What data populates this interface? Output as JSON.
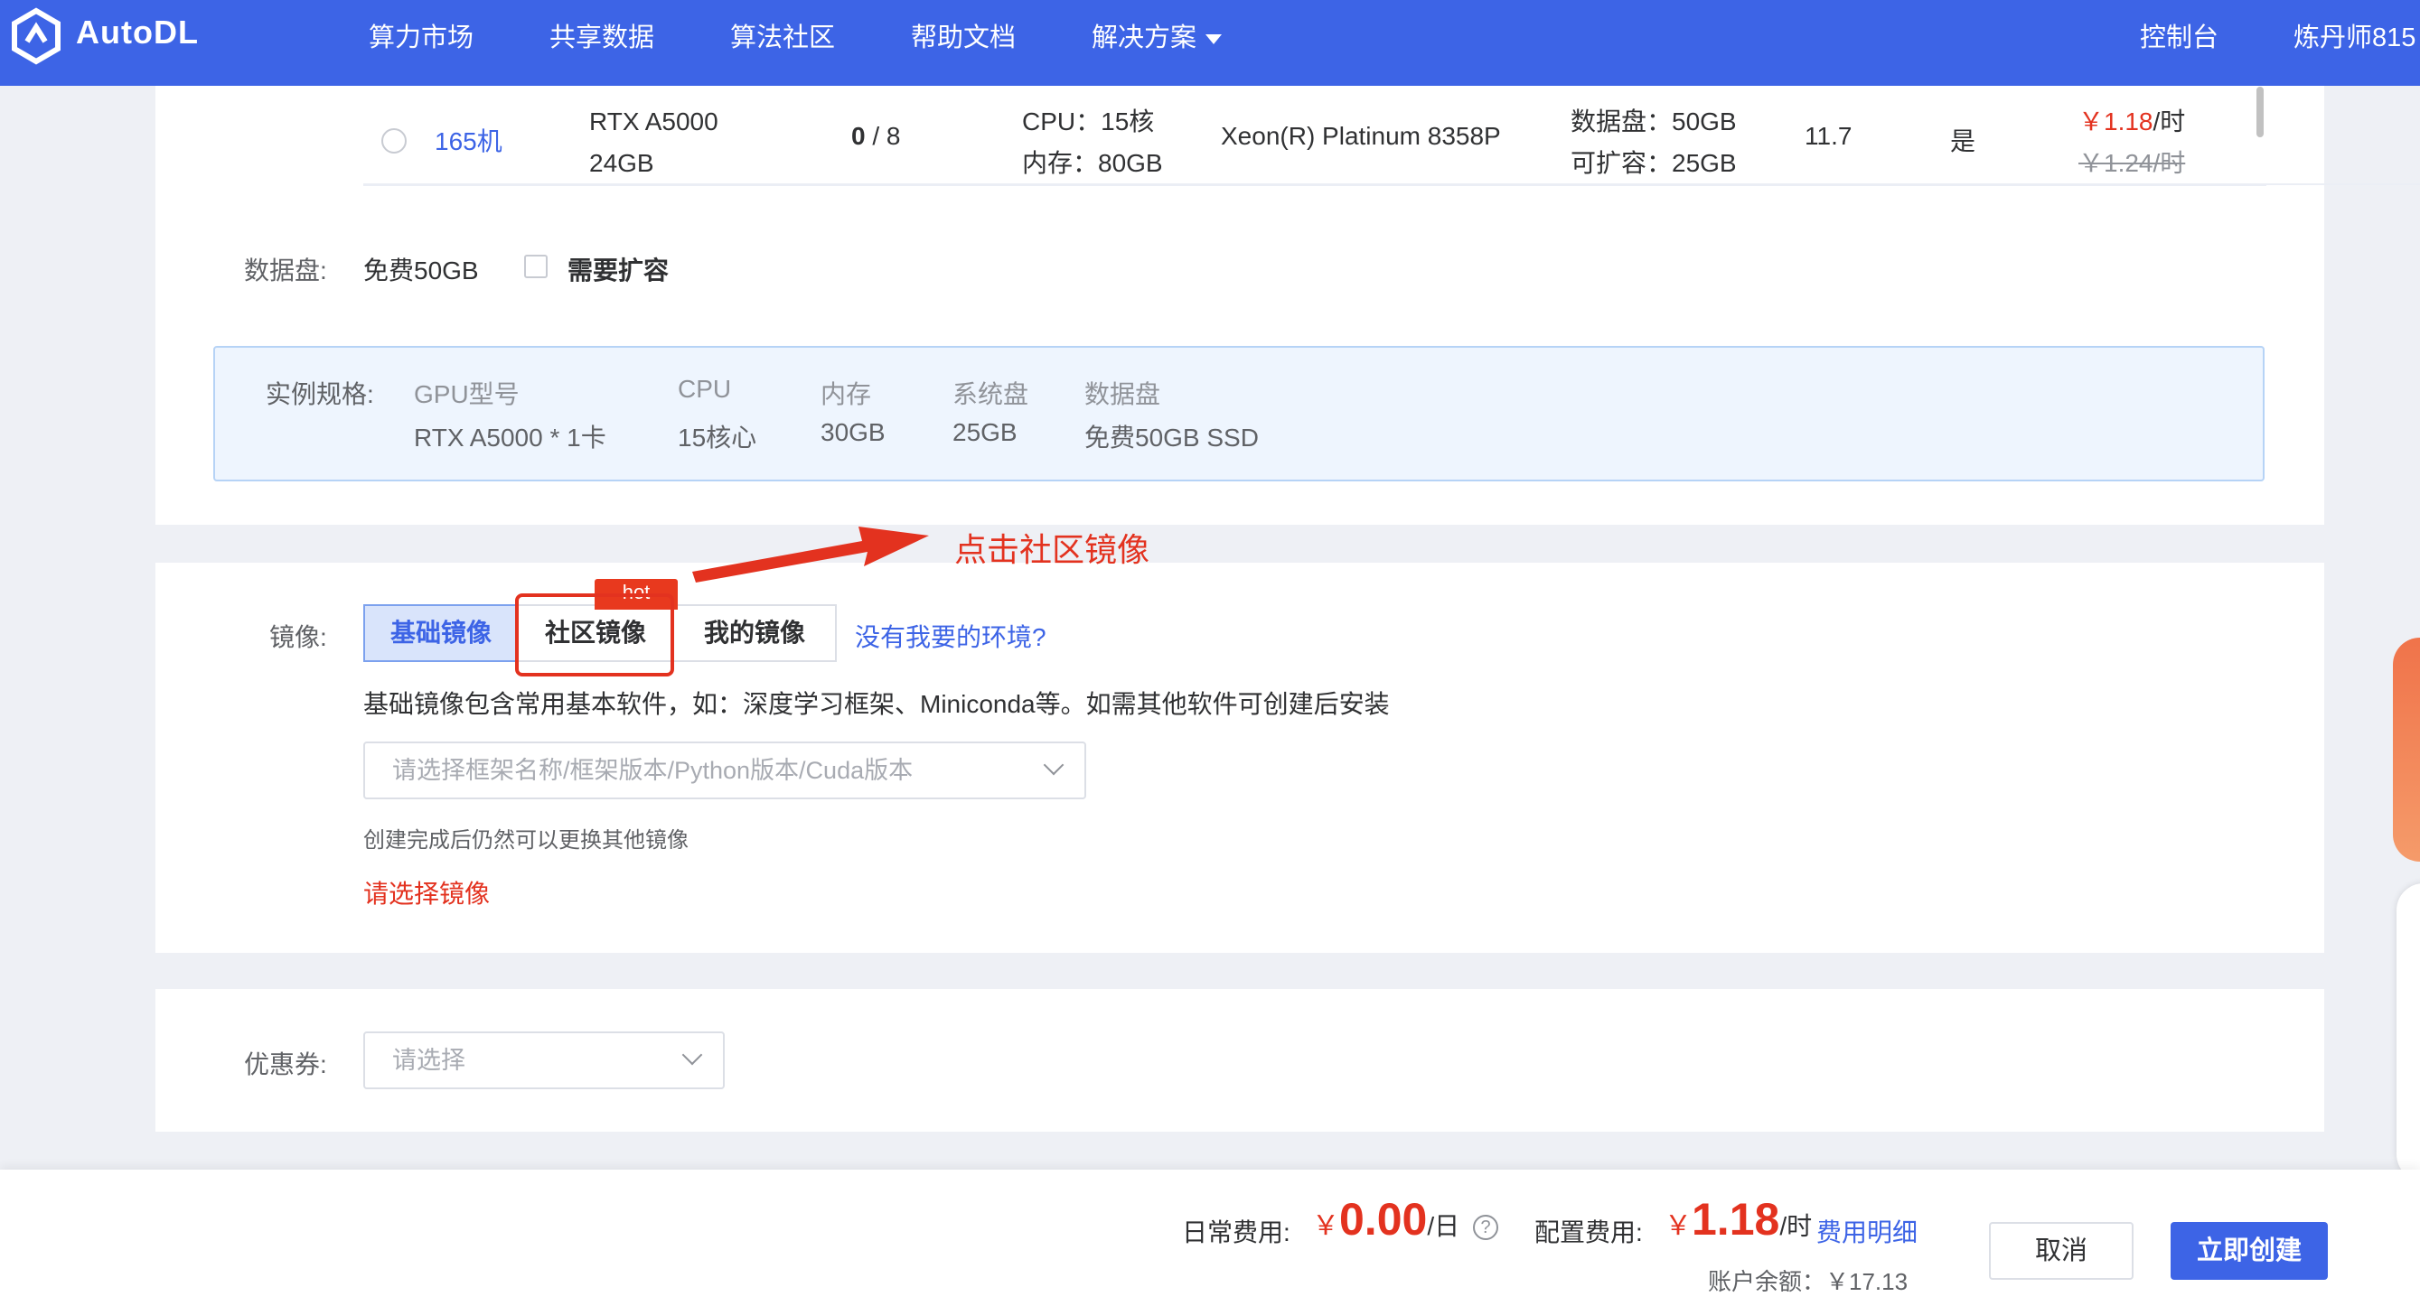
{
  "nav": {
    "brand": "AutoDL",
    "items": [
      "算力市场",
      "共享数据",
      "算法社区",
      "帮助文档",
      "解决方案"
    ],
    "console": "控制台",
    "user": "炼丹师815"
  },
  "machine_row": {
    "name": "165机",
    "gpu_line1": "RTX A5000",
    "gpu_line2": "24GB",
    "free_gpu": "0",
    "total_gpu": " / 8",
    "cpu": "CPU：15核",
    "memory": "内存：80GB",
    "cpu_model": "Xeon(R) Platinum 8358P",
    "data_disk": "数据盘：50GB",
    "expandable": "可扩容：25GB",
    "cuda": "11.7",
    "available": "是",
    "price": "￥1.18",
    "price_unit": "/时",
    "original_price": "￥1.24/时"
  },
  "data_disk": {
    "label": "数据盘:",
    "value": "免费50GB",
    "expand_label": "需要扩容"
  },
  "spec": {
    "label": "实例规格:",
    "headers": [
      "GPU型号",
      "CPU",
      "内存",
      "系统盘",
      "数据盘"
    ],
    "values": [
      "RTX A5000 * 1卡",
      "15核心",
      "30GB",
      "25GB",
      "免费50GB SSD"
    ]
  },
  "annotation": {
    "text": "点击社区镜像",
    "color": "#e3321f"
  },
  "image": {
    "label": "镜像:",
    "tabs": [
      "基础镜像",
      "社区镜像",
      "我的镜像"
    ],
    "hot": "hot",
    "no_env_link": "没有我要的环境?",
    "description": "基础镜像包含常用基本软件，如：深度学习框架、Miniconda等。如需其他软件可创建后安装",
    "select_placeholder": "请选择框架名称/框架版本/Python版本/Cuda版本",
    "hint": "创建完成后仍然可以更换其他镜像",
    "error": "请选择镜像"
  },
  "coupon": {
    "label": "优惠券:",
    "placeholder": "请选择"
  },
  "footer": {
    "daily_label": "日常费用:",
    "yen": "￥",
    "daily_value": "0.00",
    "daily_unit": "/日",
    "help": "?",
    "config_label": "配置费用:",
    "config_value": "1.18",
    "config_unit": "/时",
    "detail_link": "费用明细",
    "balance": "账户余额：￥17.13",
    "cancel": "取消",
    "create": "立即创建"
  },
  "colors": {
    "primary": "#3d64e6",
    "danger": "#e3321f",
    "link": "#3d64e6"
  }
}
